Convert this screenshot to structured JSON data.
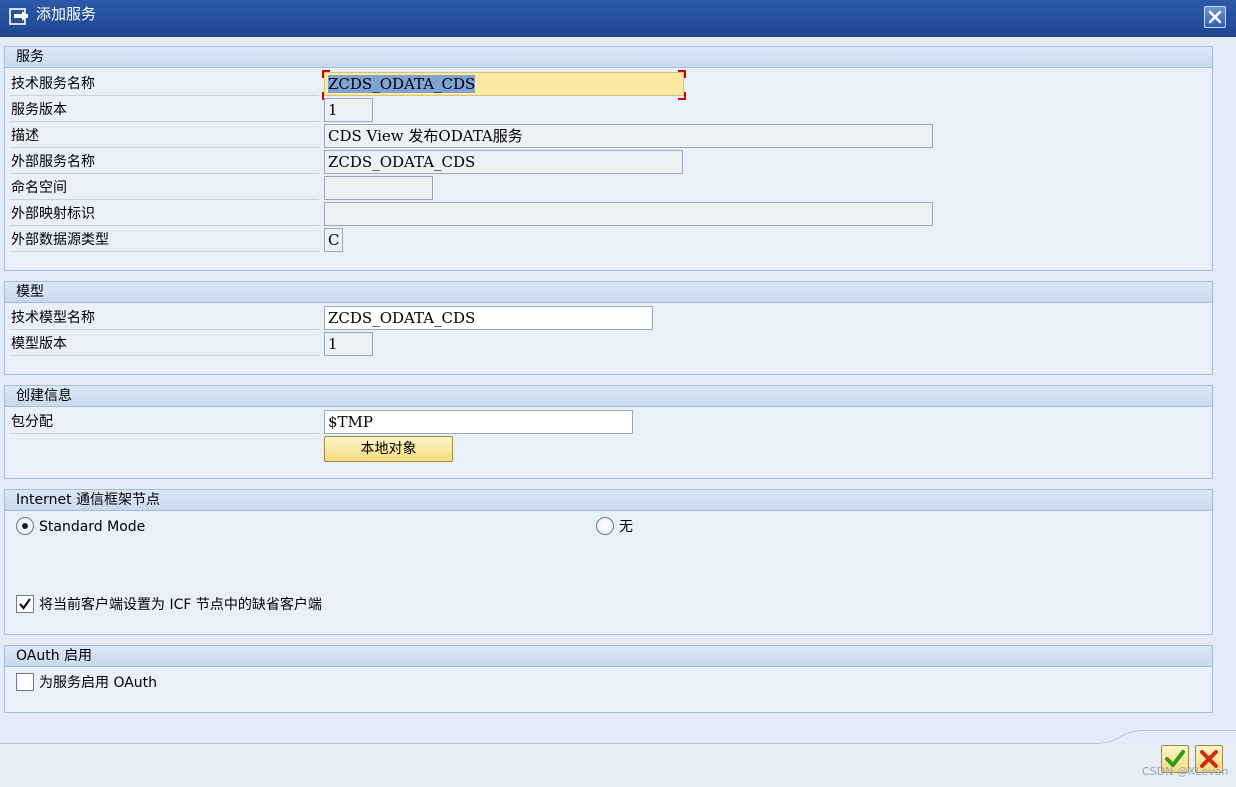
{
  "window": {
    "title": "添加服务",
    "title_icon": "dialog-icon",
    "close_icon": "close-icon"
  },
  "service_group": {
    "header": "服务",
    "rows": [
      {
        "label": "技术服务名称",
        "value": "ZCDS_ODATA_CDS"
      },
      {
        "label": "服务版本",
        "value": "1"
      },
      {
        "label": "描述",
        "value": "CDS View 发布ODATA服务"
      },
      {
        "label": "外部服务名称",
        "value": "ZCDS_ODATA_CDS"
      },
      {
        "label": "命名空间",
        "value": ""
      },
      {
        "label": "外部映射标识",
        "value": ""
      },
      {
        "label": "外部数据源类型",
        "value": "C"
      }
    ]
  },
  "model_group": {
    "header": "模型",
    "rows": [
      {
        "label": "技术模型名称",
        "value": "ZCDS_ODATA_CDS"
      },
      {
        "label": "模型版本",
        "value": "1"
      }
    ]
  },
  "creation_group": {
    "header": "创建信息",
    "package_label": "包分配",
    "package_value": "$TMP",
    "local_object_button": "本地对象"
  },
  "icf_group": {
    "header": "Internet 通信框架节点",
    "radio_standard": "Standard Mode",
    "radio_none": "无",
    "selected": "Standard Mode",
    "default_client_checkbox": "将当前客户端设置为 ICF 节点中的缺省客户端",
    "default_client_checked": true
  },
  "oauth_group": {
    "header": "OAuth 启用",
    "checkbox_label": "为服务启用 OAuth",
    "checked": false
  },
  "footer": {
    "confirm_icon": "checkmark-icon",
    "cancel_icon": "cancel-icon",
    "watermark": "CSDN @XLevon"
  },
  "colors": {
    "title_bar": "#1e4690",
    "focused_field": "#fdeaa0",
    "button": "#f3dc7f",
    "confirm_green": "#2e9a1e",
    "cancel_red": "#d02a10"
  }
}
